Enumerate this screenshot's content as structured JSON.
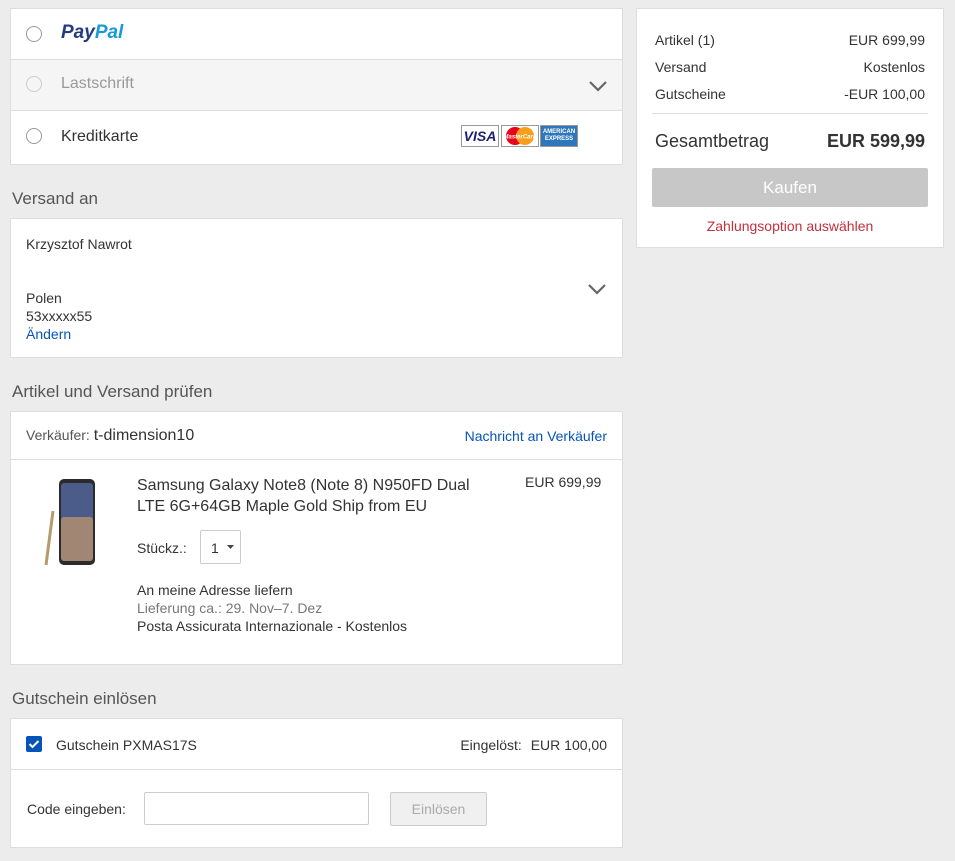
{
  "payment": {
    "options": [
      {
        "label": "PayPal"
      },
      {
        "label": "Lastschrift"
      },
      {
        "label": "Kreditkarte"
      }
    ],
    "card_logos": [
      "VISA",
      "MasterCard",
      "AMERICAN EXPRESS"
    ]
  },
  "shipping": {
    "heading": "Versand an",
    "name": "Krzysztof Nawrot",
    "country": "Polen",
    "phone": "53xxxxx55",
    "change_label": "Ändern"
  },
  "review": {
    "heading": "Artikel und Versand prüfen",
    "seller_label": "Verkäufer:",
    "seller_name": "t-dimension10",
    "message_link": "Nachricht an Verkäufer",
    "item_title_line1": "Samsung Galaxy Note8 (Note 8) N950FD Dual",
    "item_title_line2": "LTE 6G+64GB Maple Gold Ship from EU",
    "item_price": "EUR 699,99",
    "qty_label": "Stückz.:",
    "qty_value": "1",
    "delivery_method": "An meine Adresse liefern",
    "delivery_estimate": "Lieferung ca.: 29. Nov–7. Dez",
    "carrier": "Posta Assicurata Internazionale - Kostenlos"
  },
  "voucher": {
    "heading": "Gutschein einlösen",
    "applied_label": "Gutschein PXMAS17S",
    "redeemed_label": "Eingelöst:",
    "redeemed_value": "EUR 100,00",
    "code_label": "Code eingeben:",
    "code_value": "",
    "redeem_button": "Einlösen"
  },
  "summary": {
    "rows": [
      {
        "label": "Artikel (1)",
        "value": "EUR 699,99"
      },
      {
        "label": "Versand",
        "value": "Kostenlos"
      },
      {
        "label": "Gutscheine",
        "value": "-EUR 100,00"
      }
    ],
    "total_label": "Gesamtbetrag",
    "total_value": "EUR 599,99",
    "buy_button": "Kaufen",
    "hint": "Zahlungsoption auswählen"
  },
  "colors": {
    "paypal_dark": "#253b80",
    "paypal_light": "#179bd7",
    "link": "#0654ba",
    "hint": "#c3303d",
    "buy_disabled": "#c7c7c7",
    "checkbox": "#0654ba"
  }
}
